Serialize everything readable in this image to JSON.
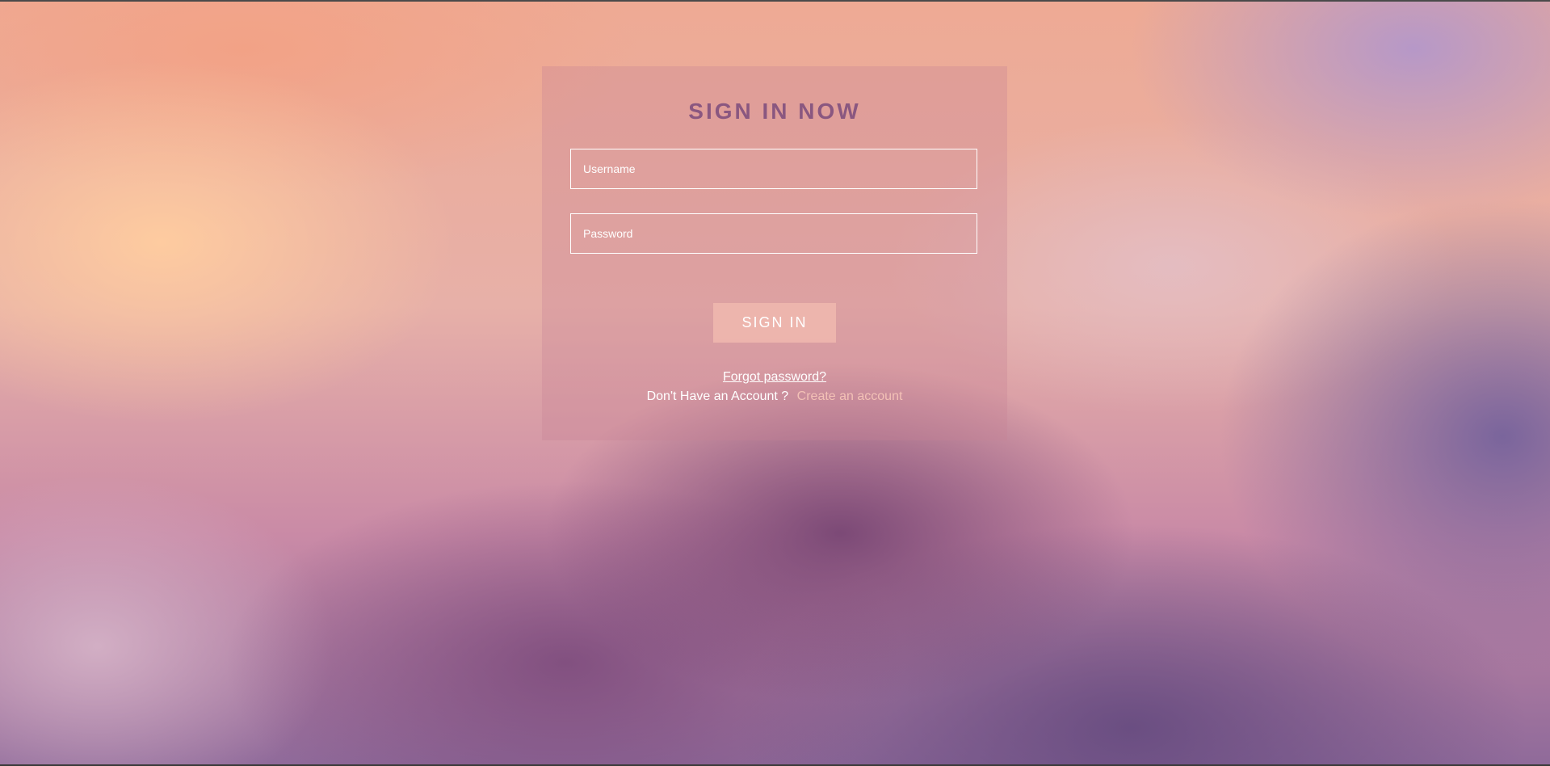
{
  "login": {
    "title": "SIGN IN NOW",
    "username_placeholder": "Username",
    "password_placeholder": "Password",
    "signin_label": "SIGN IN",
    "forgot_label": "Forgot password?",
    "no_account_text": "Don't Have an Account ?",
    "create_account_label": "Create an account"
  },
  "colors": {
    "title": "#8a5780",
    "button_bg": "#f0b9af",
    "create_link": "#f3c1b6",
    "text": "#ffffff"
  }
}
